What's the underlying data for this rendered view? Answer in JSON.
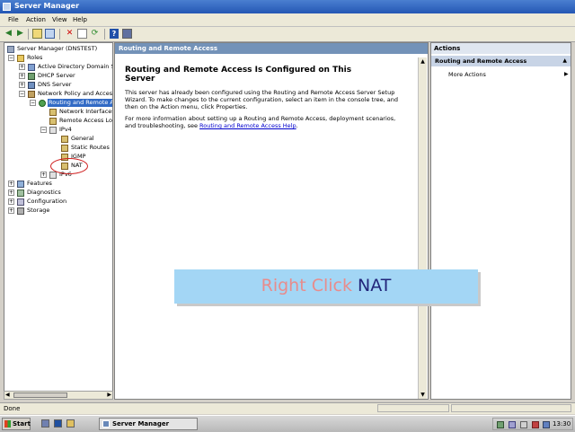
{
  "window": {
    "title": "Server Manager"
  },
  "menu": {
    "items": [
      "File",
      "Action",
      "View",
      "Help"
    ]
  },
  "tree": {
    "nodes": [
      {
        "label": "Server Manager (DNSTEST)"
      },
      {
        "label": "Roles"
      },
      {
        "label": "Active Directory Domain Se"
      },
      {
        "label": "DHCP Server"
      },
      {
        "label": "DNS Server"
      },
      {
        "label": "Network Policy and Access"
      },
      {
        "label": "Routing and Remote Ac"
      },
      {
        "label": "Network Interfaces"
      },
      {
        "label": "Remote Access Log"
      },
      {
        "label": "IPv4"
      },
      {
        "label": "General"
      },
      {
        "label": "Static Routes"
      },
      {
        "label": "IGMP"
      },
      {
        "label": "NAT"
      },
      {
        "label": "IPv6"
      },
      {
        "label": "Features"
      },
      {
        "label": "Diagnostics"
      },
      {
        "label": "Configuration"
      },
      {
        "label": "Storage"
      }
    ]
  },
  "center": {
    "header": "Routing and Remote Access",
    "heading": "Routing and Remote Access Is Configured on This Server",
    "paragraph1": "This server has already been configured using the Routing and Remote Access Server Setup Wizard. To make changes to the current configuration, select an item in the console tree, and then on the Action menu, click Properties.",
    "paragraph2_text": "For more information about setting up a Routing and Remote Access, deployment scenarios, and troubleshooting, see ",
    "paragraph2_link": "Routing and Remote Access Help",
    "paragraph2_end": "."
  },
  "actions": {
    "header": "Actions",
    "section": "Routing and Remote Access",
    "items": [
      "More Actions"
    ]
  },
  "status": {
    "text": "Done"
  },
  "taskbar": {
    "start": "Start",
    "task": "Server Manager",
    "clock": "13:30"
  },
  "overlay": {
    "part1": "Right Click ",
    "part2": "NAT"
  },
  "colors": {
    "title_bar": "#2457b4",
    "selection": "#316ac5",
    "center_header": "#7392b8",
    "overlay_bg": "#a3d6f5",
    "overlay_text1": "#e88c8c",
    "overlay_text2": "#22247a",
    "annotation_circle": "#d02020"
  }
}
